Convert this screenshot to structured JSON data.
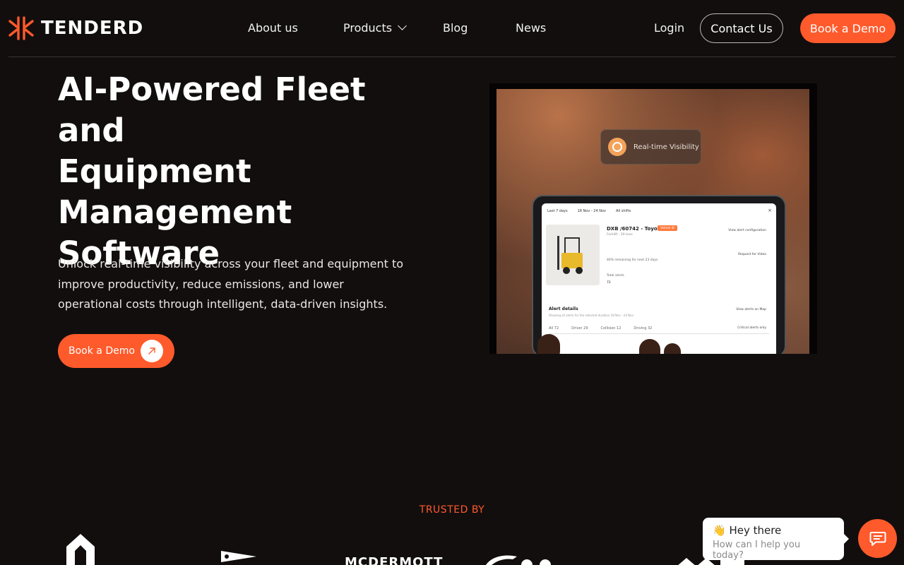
{
  "brand": {
    "name": "TENDERD",
    "accent": "#ff5a2b"
  },
  "nav": {
    "about": "About us",
    "products": "Products",
    "blog": "Blog",
    "news": "News",
    "login": "Login",
    "contact": "Contact Us",
    "book_demo": "Book a Demo"
  },
  "hero": {
    "title_lines": [
      "AI-Powered Fleet and",
      "Equipment",
      "Management",
      "Software"
    ],
    "subtitle": "Unlock real-time visibility across your fleet and equipment to improve productivity, reduce emissions, and lower operational costs through intelligent, data-driven insights.",
    "cta": "Book a Demo",
    "image": {
      "pill": "Real-time Visibility",
      "filters": [
        "Last 7 days",
        "18 Nov - 24 Nov",
        "All shifts"
      ],
      "vehicle": "DXB /60742 - Toyota",
      "badge": "Vehicle ID",
      "vehicle_sub": "Forklift - 20 tons",
      "view_alert_config": "View alert configuration",
      "request_video": "Request for Video",
      "data_line": "46% remaining for next 23 days",
      "total_alerts": "Total alerts",
      "total_value": "72",
      "alert_details": "Alert details",
      "alert_details_sub": "Showing all alerts for the selected duration 18 Nov - 24 Nov",
      "view_on_map": "View alerts on Map",
      "tabs": [
        "All 72",
        "Driver 29",
        "Collision 12",
        "Driving 32"
      ],
      "critical_only": "Critical alerts only"
    }
  },
  "trusted": {
    "label": "TRUSTED BY",
    "logos": [
      "MCDERMOTT"
    ]
  },
  "chat": {
    "greeting": "👋 Hey there",
    "prompt": "How can I help you today?"
  }
}
